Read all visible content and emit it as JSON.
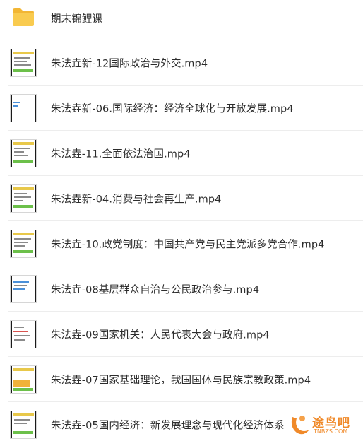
{
  "items": [
    {
      "name": "期末锦鲤课",
      "type": "folder"
    },
    {
      "name": "朱法垚新-12国际政治与外交.mp4",
      "type": "video"
    },
    {
      "name": "朱法垚新-06.国际经济：经济全球化与开放发展.mp4",
      "type": "video"
    },
    {
      "name": "朱法垚-11.全面依法治国.mp4",
      "type": "video"
    },
    {
      "name": "朱法垚新-04.消费与社会再生产.mp4",
      "type": "video"
    },
    {
      "name": "朱法垚-10.政党制度：中国共产党与民主党派多党合作.mp4",
      "type": "video"
    },
    {
      "name": "朱法垚-08基层群众自治与公民政治参与.mp4",
      "type": "video"
    },
    {
      "name": "朱法垚-09国家机关：人民代表大会与政府.mp4",
      "type": "video"
    },
    {
      "name": "朱法垚-07国家基础理论，我国国体与民族宗教政策.mp4",
      "type": "video"
    },
    {
      "name": "朱法垚-05国内经济：新发展理念与现代化经济体系",
      "type": "video"
    }
  ],
  "watermark": {
    "text": "途鸟吧",
    "sub": "TNBZS.COM"
  },
  "colors": {
    "folder": "#f7c443",
    "text": "#2c2c2c",
    "divider": "#ededed",
    "watermark": "#f08a2a"
  }
}
